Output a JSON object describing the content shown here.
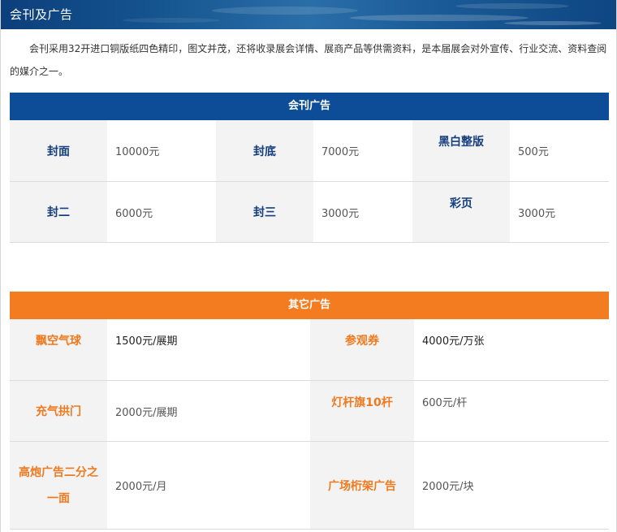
{
  "banner": {
    "title": "会刊及广告"
  },
  "intro": {
    "text": "会刊采用32开进口铜版纸四色精印，图文并茂，还将收录展会详情、展商产品等供需资料，是本届展会对外宣传、行业交流、资料查阅的媒介之一。"
  },
  "journal": {
    "heading": "会刊广告",
    "rows": [
      [
        {
          "label": "封面",
          "value": "10000元"
        },
        {
          "label": "封底",
          "value": "7000元"
        },
        {
          "label": "黑白整版",
          "value": "500元"
        }
      ],
      [
        {
          "label": "封二",
          "value": "6000元"
        },
        {
          "label": "封三",
          "value": "3000元"
        },
        {
          "label": "彩页",
          "value": "3000元"
        }
      ]
    ]
  },
  "other": {
    "heading": "其它广告",
    "rows": [
      [
        {
          "label": "飘空气球",
          "value": "1500元/展期"
        },
        {
          "label": "参观券",
          "value": "4000元/万张"
        }
      ],
      [
        {
          "label": "充气拱门",
          "value": "2000元/展期"
        },
        {
          "label": "灯杆旗10杆",
          "value": "600元/杆"
        }
      ],
      [
        {
          "label_line1": "高炮广告二分之",
          "label_line2": "一面",
          "value": "2000元/月"
        },
        {
          "label": "广场桁架广告",
          "value": "2000元/块"
        }
      ]
    ]
  },
  "colors": {
    "blue": "#0d4c97",
    "orange": "#f47c20",
    "label_bg": "#f3f3f3"
  }
}
